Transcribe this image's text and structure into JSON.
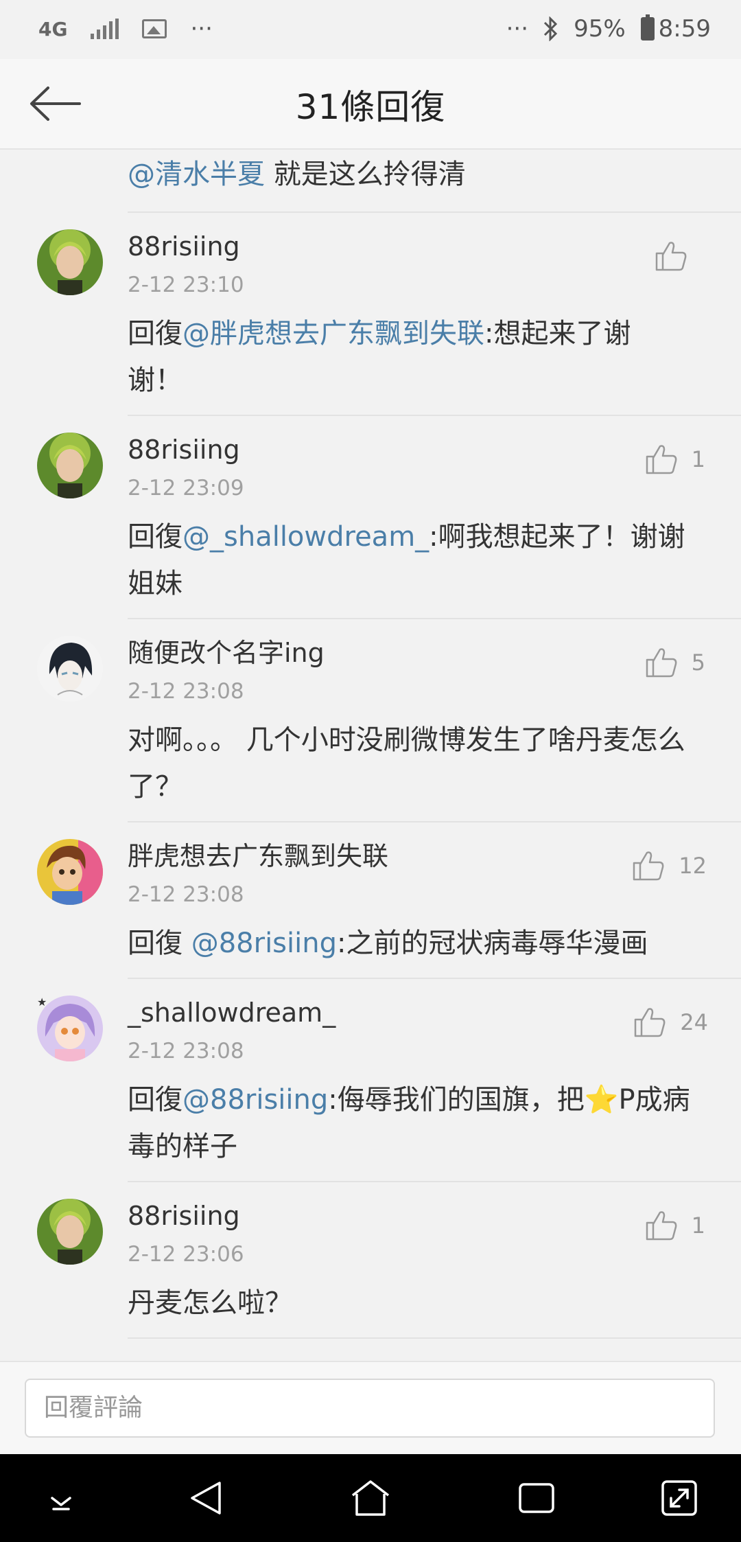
{
  "status_bar": {
    "network": "4G",
    "more_left": "···",
    "more_right": "···",
    "battery": "95%",
    "time": "8:59"
  },
  "header": {
    "title": "31條回復"
  },
  "partial_comment": {
    "mention": "@清水半夏",
    "text": " 就是这么拎得清"
  },
  "comments": [
    {
      "name": "88risiing",
      "time": "2-12 23:10",
      "prefix": "回復",
      "mention": "@胖虎想去广东飘到失联",
      "text": ":想起来了谢谢！",
      "likes": ""
    },
    {
      "name": "88risiing",
      "time": "2-12 23:09",
      "prefix": "回復",
      "mention": "@_shallowdream_",
      "text": ":啊我想起来了！谢谢姐妹",
      "likes": "1"
    },
    {
      "name": "随便改个名字ing",
      "time": "2-12 23:08",
      "prefix": "",
      "mention": "",
      "text": "对啊。。。 几个小时没刷微博发生了啥丹麦怎么了？",
      "likes": "5"
    },
    {
      "name": "胖虎想去广东飘到失联",
      "time": "2-12 23:08",
      "prefix": "回復 ",
      "mention": "@88risiing",
      "text": ":之前的冠状病毒辱华漫画",
      "likes": "12"
    },
    {
      "name": "_shallowdream_",
      "time": "2-12 23:08",
      "prefix": "回復",
      "mention": "@88risiing",
      "text": ":侮辱我们的国旗，把⭐P成病毒的样子",
      "likes": "24"
    },
    {
      "name": "88risiing",
      "time": "2-12 23:06",
      "prefix": "",
      "mention": "",
      "text": "丹麦怎么啦？",
      "likes": "1"
    }
  ],
  "reply": {
    "placeholder": "回覆評論"
  },
  "icons": {
    "back": "back-arrow-icon",
    "like": "thumbs-up-icon",
    "nav": [
      "chevron-down-icon",
      "back-triangle-icon",
      "home-icon",
      "recents-icon",
      "expand-icon"
    ]
  },
  "colors": {
    "mention": "#4a7ea8",
    "background": "#f2f2f2",
    "nav_bar": "#000000"
  }
}
